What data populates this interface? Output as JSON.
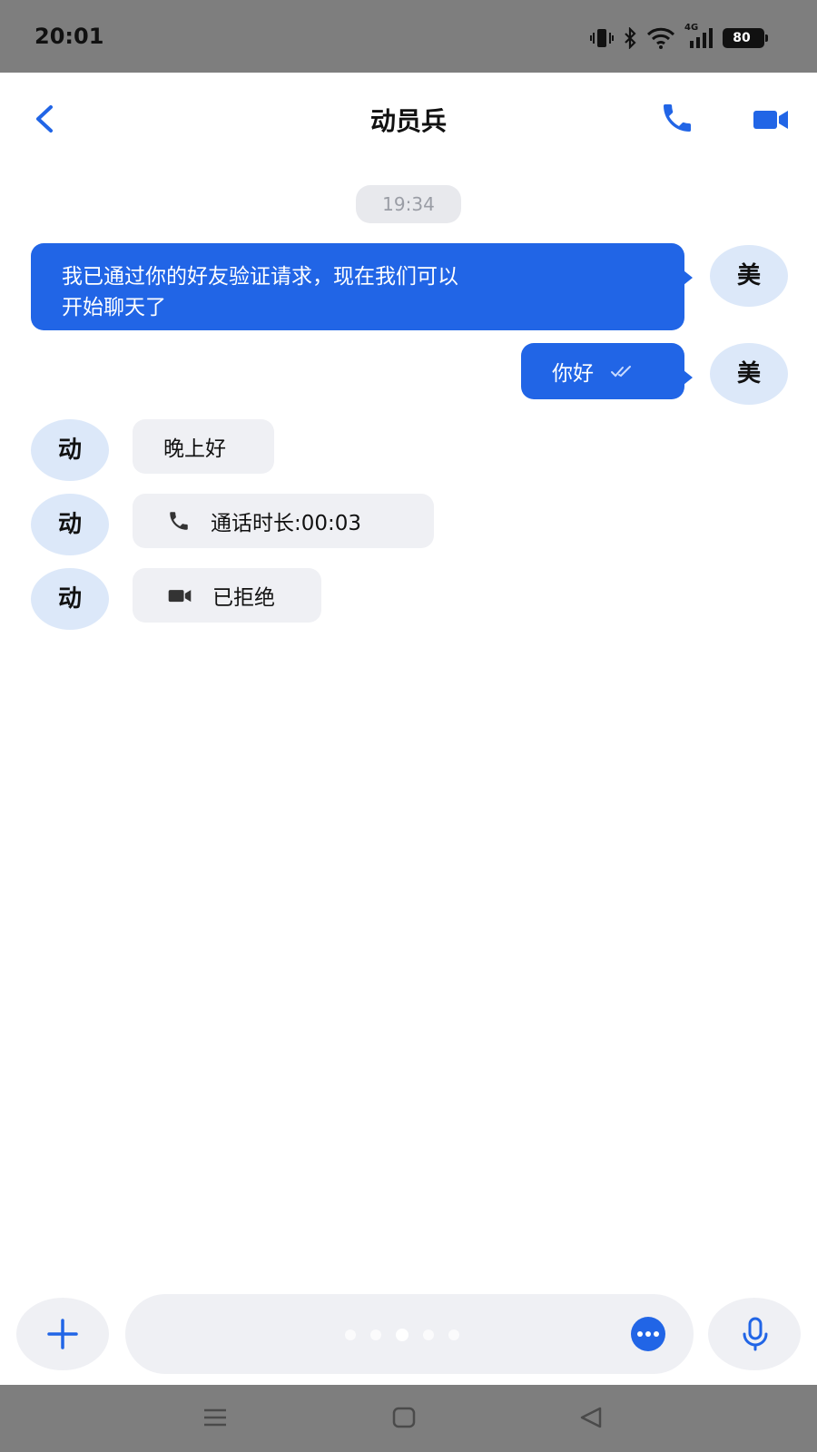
{
  "status_bar": {
    "time": "20:01",
    "network": "4G",
    "battery": "80"
  },
  "header": {
    "title": "动员兵",
    "icons": [
      "back-chevron-icon",
      "phone-icon",
      "video-camera-icon"
    ]
  },
  "conversation": {
    "timestamp": "19:34",
    "messages": [
      {
        "sender": "self",
        "avatar": "美",
        "text_line1": "我已通过你的好友验证请求，现在我们可以",
        "text_line2": "开始聊天了"
      },
      {
        "sender": "self",
        "avatar": "美",
        "text": "你好",
        "status_icon": "double-check-icon"
      },
      {
        "sender": "contact",
        "avatar": "动",
        "text": "晚上好"
      },
      {
        "sender": "contact",
        "avatar": "动",
        "icon": "phone-icon",
        "text": "通话时长:00:03"
      },
      {
        "sender": "contact",
        "avatar": "动",
        "icon": "video-camera-icon",
        "text": "已拒绝"
      }
    ]
  },
  "input_bar": {
    "page_dots": 5,
    "active_dot": 3,
    "icons": [
      "plus-icon",
      "emoji-icon",
      "microphone-icon"
    ]
  },
  "nav_bar": {
    "icons": [
      "menu-icon",
      "home-icon",
      "back-triangle-icon"
    ]
  },
  "colors": {
    "accent": "#2165e6",
    "bubble_in": "#eff0f4",
    "avatar_bg": "#dce8f9",
    "system_bar": "#7e7e7e"
  }
}
